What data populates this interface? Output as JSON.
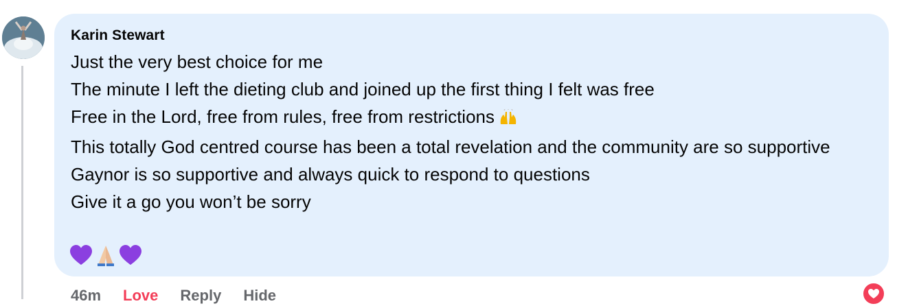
{
  "comment": {
    "author": "Karin Stewart",
    "lines": [
      "Just the very best choice for me",
      "The minute I left the dieting club and joined up the first thing I felt was free",
      "Free in the Lord, free from rules, free from restrictions",
      "This totally God centred course has been a total revelation and the community are so supportive",
      "Gaynor is so supportive and always quick to respond to questions",
      "Give it a go you won’t be sorry"
    ],
    "inline_emoji": "raising-hands-emoji",
    "emoji_row": [
      "purple-heart-emoji",
      "folded-hands-emoji",
      "purple-heart-emoji"
    ]
  },
  "actions": {
    "timestamp": "46m",
    "love": "Love",
    "reply": "Reply",
    "hide": "Hide"
  },
  "reaction": {
    "icon": "love-reaction-icon",
    "color": "#f33e58"
  },
  "colors": {
    "bubble_bg": "#e4f0fd",
    "love_text": "#f33e58",
    "muted_text": "#65676b"
  }
}
